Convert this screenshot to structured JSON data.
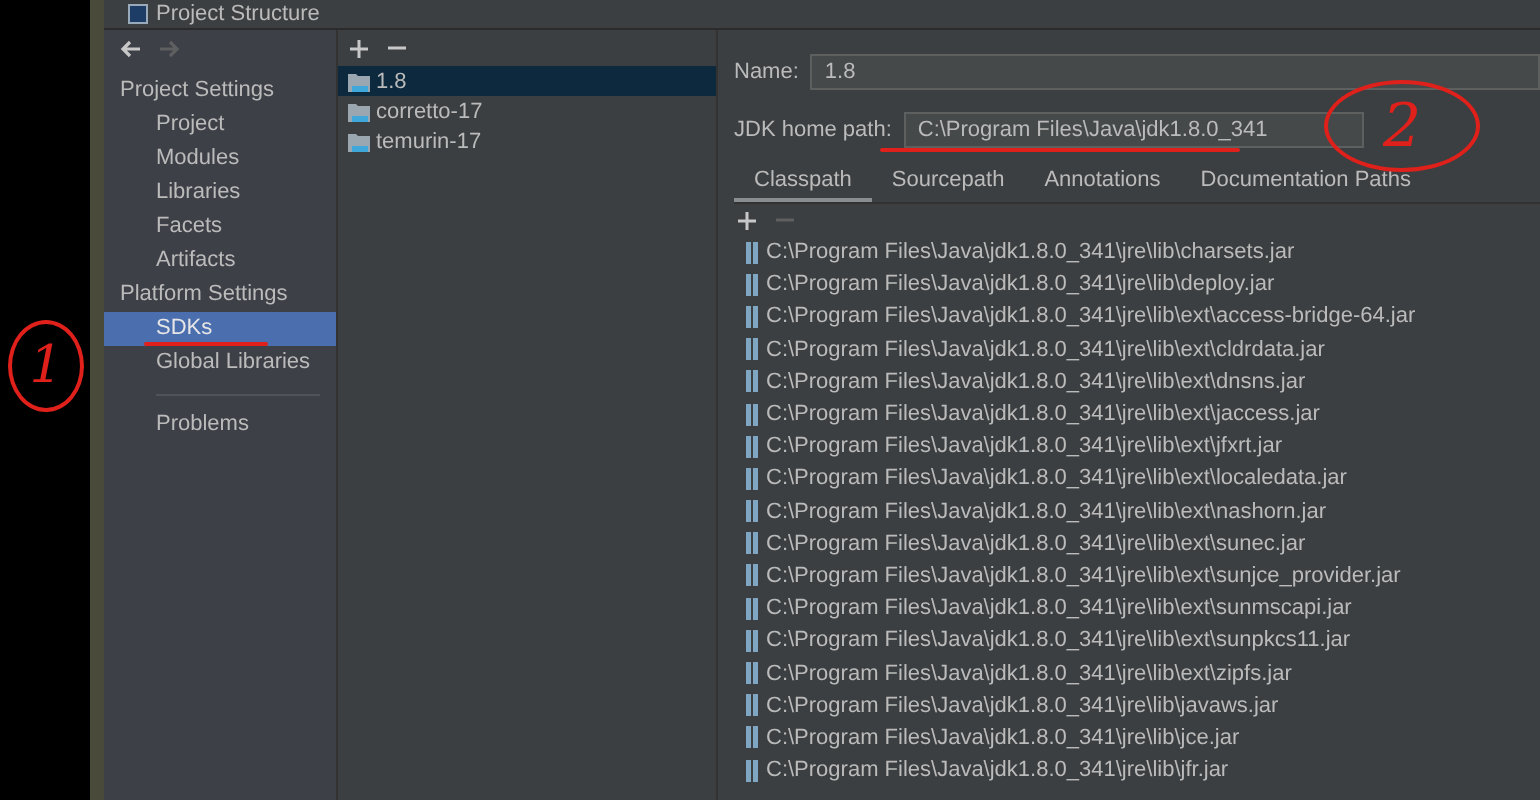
{
  "window": {
    "title": "Project Structure"
  },
  "sidebar": {
    "sections": [
      {
        "heading": "Project Settings",
        "items": [
          {
            "label": "Project",
            "selected": false
          },
          {
            "label": "Modules",
            "selected": false
          },
          {
            "label": "Libraries",
            "selected": false
          },
          {
            "label": "Facets",
            "selected": false
          },
          {
            "label": "Artifacts",
            "selected": false
          }
        ]
      },
      {
        "heading": "Platform Settings",
        "items": [
          {
            "label": "SDKs",
            "selected": true
          },
          {
            "label": "Global Libraries",
            "selected": false
          }
        ]
      }
    ],
    "problems": {
      "label": "Problems",
      "selected": false
    }
  },
  "sdk_list": {
    "items": [
      {
        "label": "1.8",
        "selected": true
      },
      {
        "label": "corretto-17",
        "selected": false
      },
      {
        "label": "temurin-17",
        "selected": false
      }
    ]
  },
  "sdk": {
    "name_label": "Name:",
    "name": "1.8",
    "home_label": "JDK home path:",
    "home_path": "C:\\Program Files\\Java\\jdk1.8.0_341",
    "tabs": [
      {
        "label": "Classpath",
        "selected": true
      },
      {
        "label": "Sourcepath",
        "selected": false
      },
      {
        "label": "Annotations",
        "selected": false
      },
      {
        "label": "Documentation Paths",
        "selected": false
      }
    ],
    "entries": [
      "C:\\Program Files\\Java\\jdk1.8.0_341\\jre\\lib\\charsets.jar",
      "C:\\Program Files\\Java\\jdk1.8.0_341\\jre\\lib\\deploy.jar",
      "C:\\Program Files\\Java\\jdk1.8.0_341\\jre\\lib\\ext\\access-bridge-64.jar",
      "C:\\Program Files\\Java\\jdk1.8.0_341\\jre\\lib\\ext\\cldrdata.jar",
      "C:\\Program Files\\Java\\jdk1.8.0_341\\jre\\lib\\ext\\dnsns.jar",
      "C:\\Program Files\\Java\\jdk1.8.0_341\\jre\\lib\\ext\\jaccess.jar",
      "C:\\Program Files\\Java\\jdk1.8.0_341\\jre\\lib\\ext\\jfxrt.jar",
      "C:\\Program Files\\Java\\jdk1.8.0_341\\jre\\lib\\ext\\localedata.jar",
      "C:\\Program Files\\Java\\jdk1.8.0_341\\jre\\lib\\ext\\nashorn.jar",
      "C:\\Program Files\\Java\\jdk1.8.0_341\\jre\\lib\\ext\\sunec.jar",
      "C:\\Program Files\\Java\\jdk1.8.0_341\\jre\\lib\\ext\\sunjce_provider.jar",
      "C:\\Program Files\\Java\\jdk1.8.0_341\\jre\\lib\\ext\\sunmscapi.jar",
      "C:\\Program Files\\Java\\jdk1.8.0_341\\jre\\lib\\ext\\sunpkcs11.jar",
      "C:\\Program Files\\Java\\jdk1.8.0_341\\jre\\lib\\ext\\zipfs.jar",
      "C:\\Program Files\\Java\\jdk1.8.0_341\\jre\\lib\\javaws.jar",
      "C:\\Program Files\\Java\\jdk1.8.0_341\\jre\\lib\\jce.jar",
      "C:\\Program Files\\Java\\jdk1.8.0_341\\jre\\lib\\jfr.jar"
    ]
  },
  "annotations": [
    {
      "text": "1"
    },
    {
      "text": "2"
    }
  ]
}
